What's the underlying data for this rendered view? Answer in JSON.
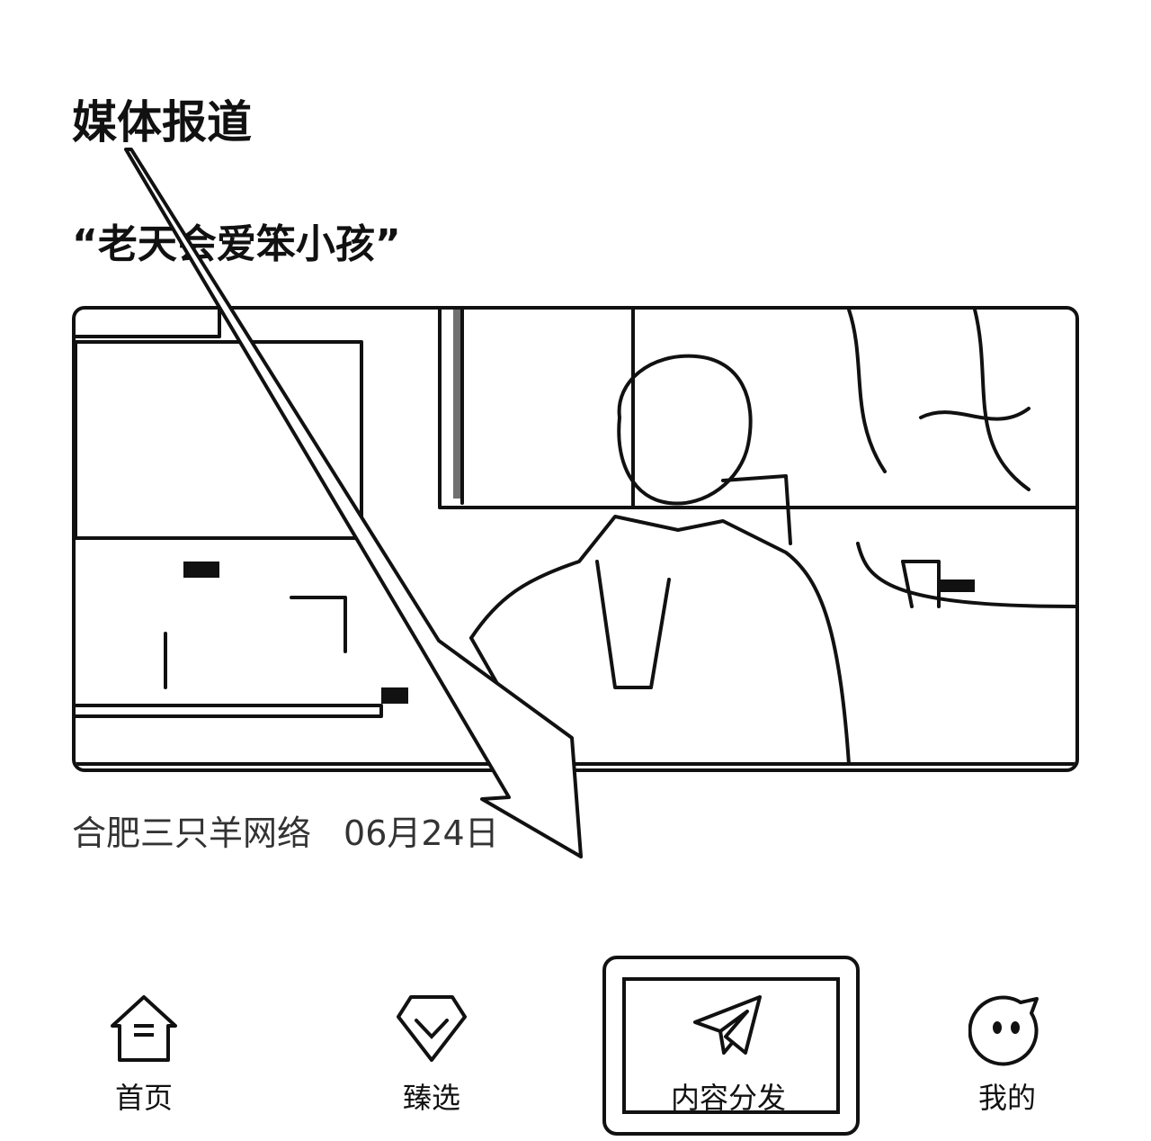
{
  "section": {
    "title": "媒体报道"
  },
  "article": {
    "title": "“老天会爱笨小孩”",
    "source": "合肥三只羊网络",
    "date": "06月24日"
  },
  "tabbar": {
    "items": [
      {
        "label": "首页",
        "icon": "home-icon",
        "active": false
      },
      {
        "label": "臻选",
        "icon": "select-icon",
        "active": false
      },
      {
        "label": "内容分发",
        "icon": "paper-plane-icon",
        "active": true
      },
      {
        "label": "我的",
        "icon": "chat-face-icon",
        "active": false
      }
    ]
  }
}
